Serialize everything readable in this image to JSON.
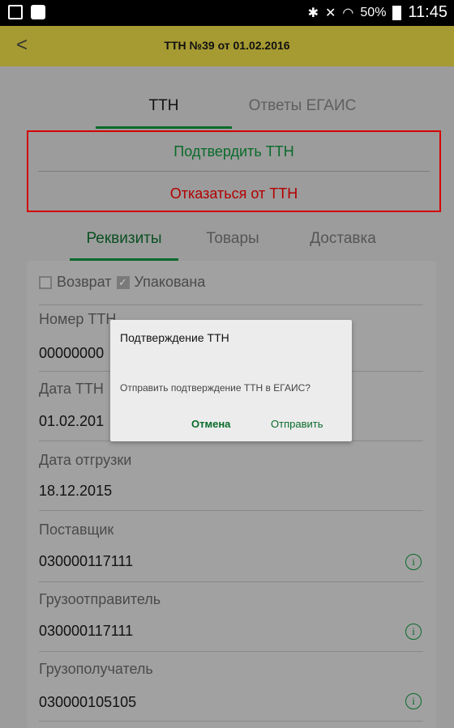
{
  "status_bar": {
    "battery": "50%",
    "time": "11:45",
    "icons": [
      "picture-icon",
      "bag-icon",
      "bluetooth-icon",
      "mute-icon",
      "wifi-icon",
      "battery-icon"
    ]
  },
  "app_bar": {
    "back": "<",
    "title": "ТТН №39 от 01.02.2016",
    "color": "#a69a32"
  },
  "top_tabs": [
    {
      "label": "ТТН",
      "active": true
    },
    {
      "label": "Ответы ЕГАИС",
      "active": false
    }
  ],
  "actions": {
    "confirm": "Подтвердить ТТН",
    "reject": "Отказаться от ТТН"
  },
  "sub_tabs": [
    {
      "label": "Реквизиты",
      "active": true
    },
    {
      "label": "Товары",
      "active": false
    },
    {
      "label": "Доставка",
      "active": false
    }
  ],
  "checkboxes": [
    {
      "label": "Возврат",
      "checked": false
    },
    {
      "label": "Упакована",
      "checked": true
    }
  ],
  "fields": [
    {
      "label": "Номер ТТН",
      "value": "00000000"
    },
    {
      "label": "Дата ТТН",
      "value": "01.02.201"
    },
    {
      "label": "Дата отгрузки",
      "value": "18.12.2015"
    },
    {
      "label": "Поставщик",
      "value": "030000117111"
    },
    {
      "label": "Грузоотправитель",
      "value": "030000117111"
    },
    {
      "label": "Грузополучатель",
      "value": "030000105105"
    }
  ],
  "info_glyph": "i",
  "dialog": {
    "title": "Подтверждение ТТН",
    "message": "Отправить подтверждение ТТН в ЕГАИС?",
    "cancel": "Отмена",
    "send": "Отправить"
  },
  "colors": {
    "accent_green": "#0a6b2a",
    "reject_red": "#b30000",
    "border_red": "#d40000"
  }
}
